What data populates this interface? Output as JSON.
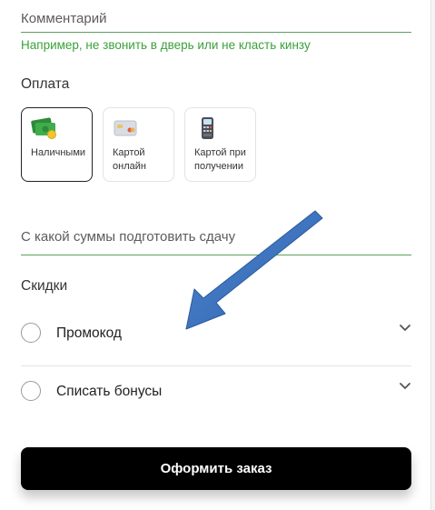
{
  "comment": {
    "placeholder": "Комментарий",
    "hint": "Например, не звонить в дверь или не класть кинзу"
  },
  "payment": {
    "title": "Оплата",
    "options": [
      {
        "label": "Наличными",
        "icon": "cash-icon",
        "selected": true
      },
      {
        "label": "Картой онлайн",
        "icon": "credit-card-icon",
        "selected": false
      },
      {
        "label": "Картой при получении",
        "icon": "pos-terminal-icon",
        "selected": false
      }
    ]
  },
  "change": {
    "placeholder": "С какой суммы подготовить сдачу"
  },
  "discounts": {
    "title": "Скидки",
    "items": [
      {
        "label": "Промокод"
      },
      {
        "label": "Списать бонусы"
      }
    ]
  },
  "order_button": "Оформить заказ",
  "colors": {
    "accent_green": "#3aa13a",
    "annotation_arrow": "#3b72c0",
    "button_bg": "#000000"
  }
}
